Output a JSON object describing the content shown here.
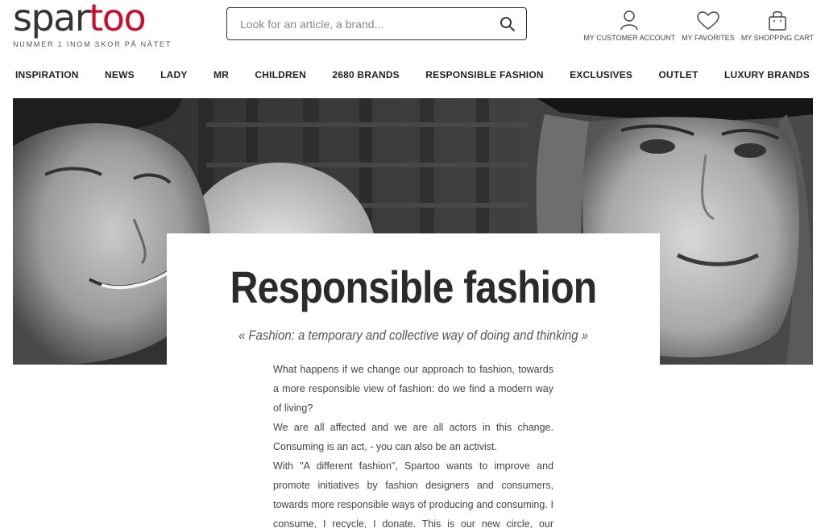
{
  "brand": {
    "logo_part1": "spar",
    "logo_part2": "too",
    "tagline": "NUMMER 1 INOM SKOR PÅ NÄTET",
    "accent_color": "#c8102e"
  },
  "search": {
    "placeholder": "Look for an article, a brand...",
    "icon": "search-icon"
  },
  "account": {
    "customer_account": "MY CUSTOMER ACCOUNT",
    "favorites": "MY FAVORITES",
    "shopping_cart": "MY SHOPPING CART"
  },
  "nav": {
    "items": [
      "INSPIRATION",
      "NEWS",
      "LADY",
      "MR",
      "CHILDREN",
      "2680 BRANDS",
      "RESPONSIBLE FASHION",
      "EXCLUSIVES",
      "OUTLET",
      "LUXURY BRANDS"
    ]
  },
  "hero": {
    "title": "Responsible fashion",
    "quote": "« Fashion: a temporary and collective way of doing and thinking »",
    "paragraphs": [
      "What happens if we change our approach to fashion, towards a more responsible view of fashion: do we find a modern way of living?",
      "We are all affected and we are all actors in this change. Consuming is an act, - you can also be an activist.",
      "With \"A different fashion\", Spartoo wants to improve and promote initiatives by fashion designers and consumers, towards more responsible ways of producing and consuming. I consume, I recycle, I donate. This is our new circle, our modern way of life."
    ]
  }
}
